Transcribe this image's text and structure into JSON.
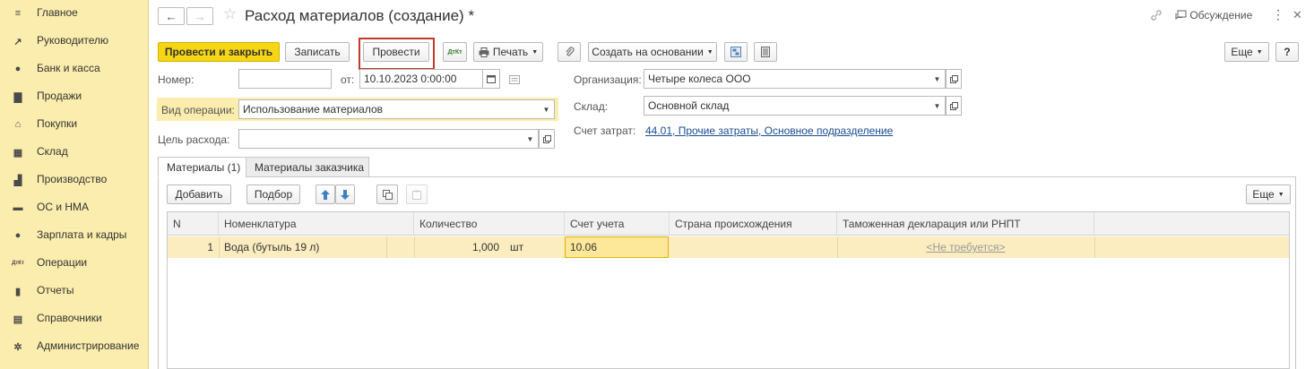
{
  "sidebar": {
    "items": [
      {
        "label": "Главное",
        "icon": "≡"
      },
      {
        "label": "Руководителю",
        "icon": "↗"
      },
      {
        "label": "Банк и касса",
        "icon": "●"
      },
      {
        "label": "Продажи",
        "icon": "▇"
      },
      {
        "label": "Покупки",
        "icon": "⌂"
      },
      {
        "label": "Склад",
        "icon": "▦"
      },
      {
        "label": "Производство",
        "icon": "▟"
      },
      {
        "label": "ОС и НМА",
        "icon": "▬"
      },
      {
        "label": "Зарплата и кадры",
        "icon": "●"
      },
      {
        "label": "Операции",
        "icon": "ДтКт"
      },
      {
        "label": "Отчеты",
        "icon": "▮"
      },
      {
        "label": "Справочники",
        "icon": "▤"
      },
      {
        "label": "Администрирование",
        "icon": "✲"
      }
    ]
  },
  "header": {
    "back_icon": "←",
    "forward_icon": "→",
    "star_icon": "☆",
    "title": "Расход материалов (создание) *",
    "link_icon": "🔗",
    "discussion_label": "Обсуждение",
    "more_icon": "⋮",
    "close_icon": "✕"
  },
  "toolbar": {
    "post_close_label": "Провести и закрыть",
    "save_label": "Записать",
    "post_label": "Провести",
    "dtkt_label": "ДтКт",
    "print_label": "Печать",
    "attach_icon": "📎",
    "create_based_label": "Создать на основании",
    "more_label": "Еще",
    "help_label": "?"
  },
  "form": {
    "number_label": "Номер:",
    "number_value": "",
    "date_from_label": "от:",
    "date_value": "10.10.2023  0:00:00",
    "org_label": "Организация:",
    "org_value": "Четыре колеса ООО",
    "op_type_label": "Вид операции:",
    "op_type_value": "Использование материалов",
    "warehouse_label": "Склад:",
    "warehouse_value": "Основной склад",
    "purpose_label": "Цель расхода:",
    "purpose_value": "",
    "cost_account_label": "Счет затрат:",
    "cost_account_value": "44.01, Прочие затраты, Основное подразделение"
  },
  "tabs": [
    {
      "label": "Материалы (1)",
      "active": true
    },
    {
      "label": "Материалы заказчика",
      "active": false
    }
  ],
  "table_toolbar": {
    "add_label": "Добавить",
    "pick_label": "Подбор",
    "more_label": "Еще"
  },
  "table": {
    "columns": [
      "N",
      "Номенклатура",
      "Количество",
      "Счет учета",
      "Страна происхождения",
      "Таможенная декларация или РНПТ"
    ],
    "rows": [
      {
        "n": "1",
        "item": "Вода (бутыль 19 л)",
        "qty": "1,000",
        "unit": "шт",
        "account": "10.06",
        "country": "",
        "customs": "<Не требуется>"
      }
    ]
  },
  "colors": {
    "sidebar_bg": "#fbedad",
    "primary_button": "#f6d515",
    "highlight": "#c0392b",
    "link": "#1a4d8f"
  }
}
